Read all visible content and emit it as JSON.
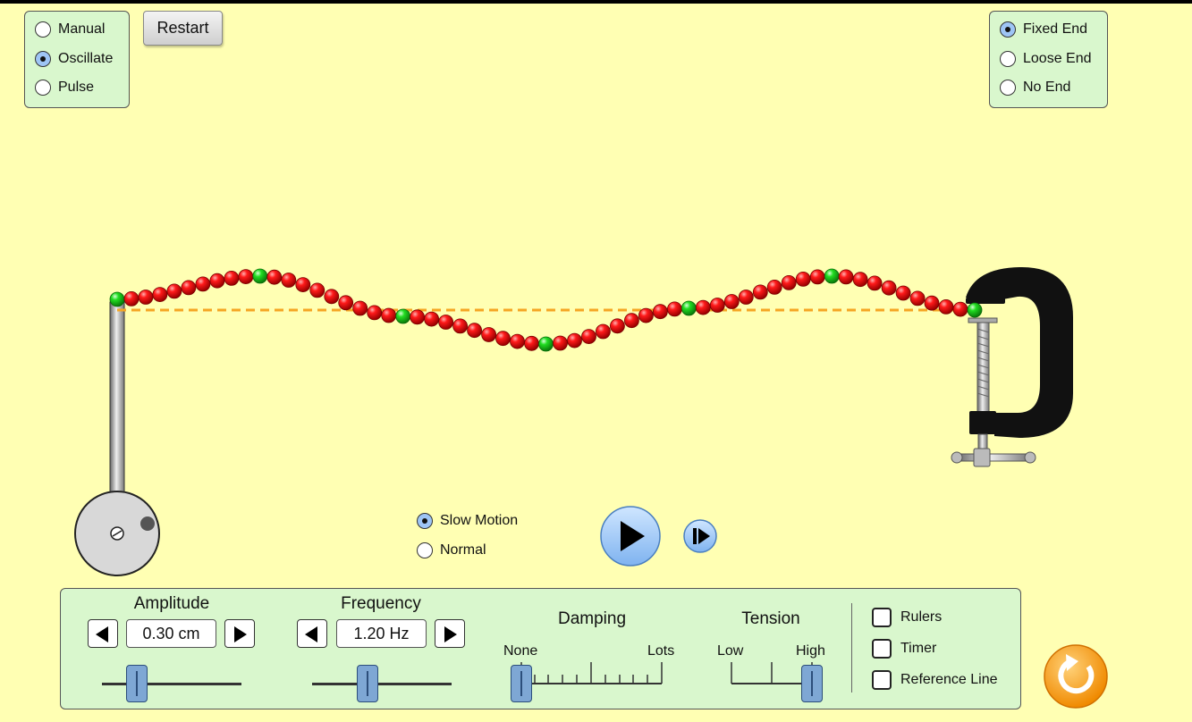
{
  "mode_panel": {
    "options": [
      {
        "label": "Manual",
        "selected": false
      },
      {
        "label": "Oscillate",
        "selected": true
      },
      {
        "label": "Pulse",
        "selected": false
      }
    ]
  },
  "restart_label": "Restart",
  "end_panel": {
    "options": [
      {
        "label": "Fixed End",
        "selected": true
      },
      {
        "label": "Loose End",
        "selected": false
      },
      {
        "label": "No End",
        "selected": false
      }
    ]
  },
  "speed": {
    "options": [
      {
        "label": "Slow Motion",
        "selected": true
      },
      {
        "label": "Normal",
        "selected": false
      }
    ]
  },
  "controls": {
    "amplitude": {
      "label": "Amplitude",
      "value": "0.30 cm",
      "fraction": 0.25
    },
    "frequency": {
      "label": "Frequency",
      "value": "1.20 Hz",
      "fraction": 0.4
    },
    "damping": {
      "label": "Damping",
      "min_label": "None",
      "max_label": "Lots",
      "fraction": 0.0
    },
    "tension": {
      "label": "Tension",
      "min_label": "Low",
      "max_label": "High",
      "fraction": 1.0
    }
  },
  "checkboxes": [
    {
      "label": "Rulers",
      "checked": false
    },
    {
      "label": "Timer",
      "checked": false
    },
    {
      "label": "Reference Line",
      "checked": false
    }
  ],
  "colors": {
    "background": "#ffffb3",
    "panel": "#d9f7cd",
    "bead": "#ee0000",
    "bead_marker": "#22dd22",
    "reference_line": "#f5a623",
    "reset_button": "#f7a21b"
  }
}
